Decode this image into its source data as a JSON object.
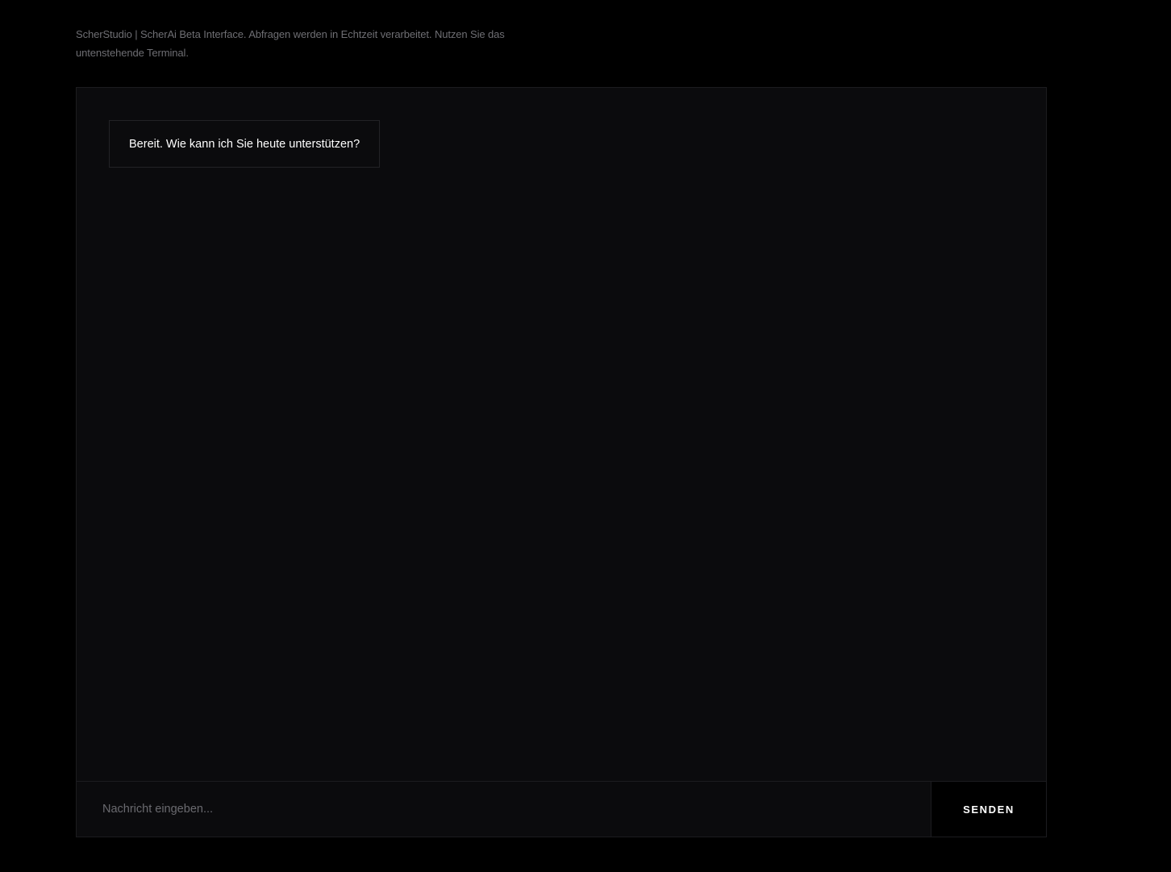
{
  "header": {
    "intro_text": "ScherStudio | ScherAi Beta Interface. Abfragen werden in Echtzeit verarbeitet. Nutzen Sie das untenstehende Terminal."
  },
  "chat": {
    "messages": [
      {
        "role": "assistant",
        "text": "Bereit. Wie kann ich Sie heute unterstützen?"
      }
    ]
  },
  "composer": {
    "placeholder": "Nachricht eingeben...",
    "value": "",
    "send_label": "SENDEN"
  },
  "colors": {
    "page_background": "#000000",
    "terminal_background": "#0b0b0d",
    "border": "#1c1c1f",
    "muted_text": "#6e6e73",
    "text": "#ffffff"
  }
}
